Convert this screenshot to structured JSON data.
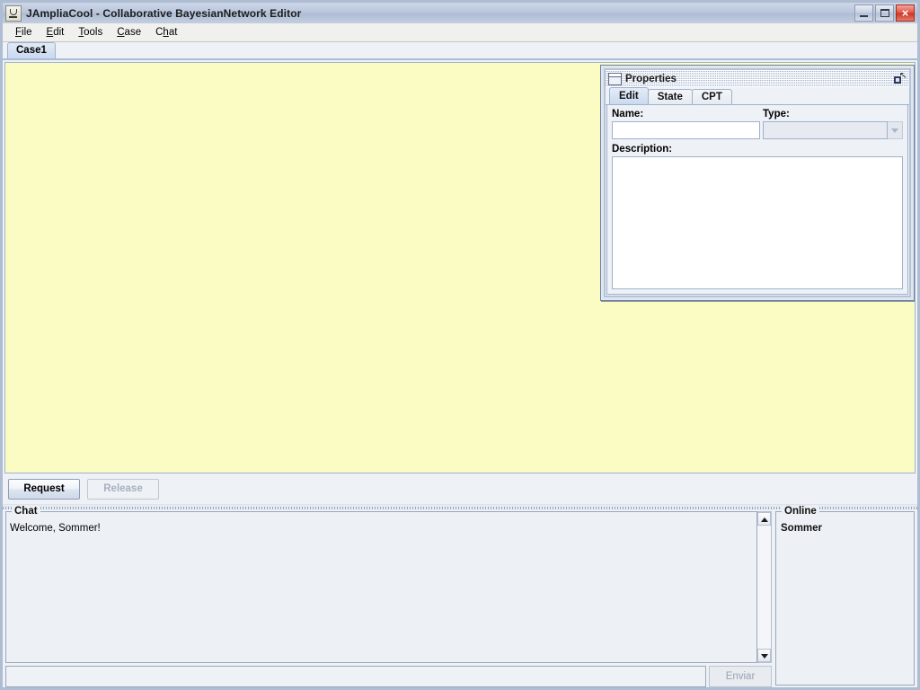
{
  "window": {
    "title": "JAmpliaCool - Collaborative BayesianNetwork Editor",
    "app_icon": "java-coffee-cup-icon",
    "controls": {
      "minimize": "minimize-icon",
      "maximize": "maximize-icon",
      "close": "×"
    }
  },
  "menubar": {
    "items": [
      {
        "label": "File",
        "mnemonic_index": 0
      },
      {
        "label": "Edit",
        "mnemonic_index": 0
      },
      {
        "label": "Tools",
        "mnemonic_index": 0
      },
      {
        "label": "Case",
        "mnemonic_index": 0
      },
      {
        "label": "Chat",
        "mnemonic_index": 2
      }
    ]
  },
  "tabs": {
    "items": [
      {
        "label": "Case1",
        "selected": true
      }
    ]
  },
  "canvas": {
    "background_color": "#fbfbc4"
  },
  "properties_frame": {
    "title": "Properties",
    "restore_button": "restore-icon",
    "tabs": [
      {
        "label": "Edit",
        "selected": true
      },
      {
        "label": "State",
        "selected": false
      },
      {
        "label": "CPT",
        "selected": false
      }
    ],
    "name_label": "Name:",
    "name_value": "",
    "type_label": "Type:",
    "type_value": "",
    "type_enabled": false,
    "description_label": "Description:",
    "description_value": ""
  },
  "control_bar": {
    "request_label": "Request",
    "request_enabled": true,
    "release_label": "Release",
    "release_enabled": false
  },
  "chat": {
    "panel_title": "Chat",
    "messages": [
      "Welcome, Sommer!"
    ],
    "input_value": "",
    "input_placeholder": "",
    "send_label": "Enviar",
    "send_enabled": false
  },
  "online": {
    "panel_title": "Online",
    "users": [
      "Sommer"
    ]
  },
  "colors": {
    "canvas": "#fbfbc4",
    "frame": "#aebdd4",
    "panel": "#eef1f6",
    "close_button": "#cf3726",
    "tab_selected": "#cbdaef"
  }
}
